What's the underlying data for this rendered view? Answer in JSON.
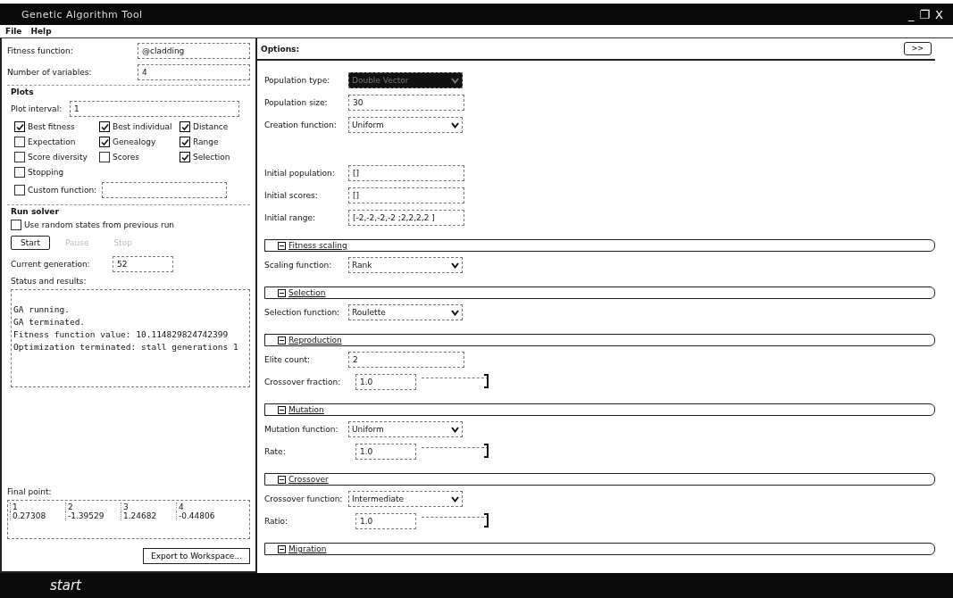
{
  "window": {
    "title": "Genetic Algorithm Tool",
    "controls": [
      "_",
      "❐",
      "X"
    ]
  },
  "menu": [
    "File",
    "Help"
  ],
  "problem": [
    {
      "label": "Fitness function:",
      "value": "@cladding"
    },
    {
      "label": "Number of variables:",
      "value": "4"
    }
  ],
  "plots": {
    "title": "Plots",
    "interval_label": "Plot interval:",
    "interval": "1",
    "checks": [
      {
        "label": "Best fitness",
        "checked": true
      },
      {
        "label": "Best individual",
        "checked": true
      },
      {
        "label": "Distance",
        "checked": true
      },
      {
        "label": "Expectation",
        "checked": false
      },
      {
        "label": "Genealogy",
        "checked": true
      },
      {
        "label": "Range",
        "checked": true
      },
      {
        "label": "Score diversity",
        "checked": false
      },
      {
        "label": "Scores",
        "checked": false
      },
      {
        "label": "Selection",
        "checked": true
      },
      {
        "label": "Stopping",
        "checked": false
      }
    ],
    "custom": {
      "label": "Custom function:",
      "checked": false
    }
  },
  "run_solver": {
    "title": "Run solver",
    "random_states": {
      "label": "Use random states from previous run",
      "checked": false
    },
    "buttons": [
      {
        "label": "Start",
        "disabled": false
      },
      {
        "label": "Pause",
        "disabled": true
      },
      {
        "label": "Stop",
        "disabled": true
      }
    ],
    "generation_label": "Current generation:",
    "generation": "52",
    "status_label": "Status and results:",
    "status_lines": [
      "GA running.",
      "GA terminated.",
      "Fitness function value: 10.114829824742399",
      "Optimization terminated: stall generations 1"
    ]
  },
  "final_point": {
    "label": "Final point:",
    "columns": [
      "1",
      "2",
      "3",
      "4"
    ],
    "values": [
      "0.27308",
      "-1.39529",
      "1.24682",
      "-0.44806"
    ]
  },
  "export_button": "Export to Workspace...",
  "options": {
    "title": "Options:",
    "toggle": ">>",
    "general": [
      {
        "kind": "select",
        "label": "Population type:",
        "value": "Double Vector",
        "selected": true
      },
      {
        "kind": "field",
        "label": "Population size:",
        "value": "30"
      },
      {
        "kind": "select",
        "label": "Creation function:",
        "value": "Uniform",
        "selected": false
      },
      {
        "kind": "gap"
      },
      {
        "kind": "field",
        "label": "Initial population:",
        "value": "[]"
      },
      {
        "kind": "field",
        "label": "Initial scores:",
        "value": "[]"
      },
      {
        "kind": "field",
        "label": "Initial range:",
        "value": "[-2,-2,-2,-2 ;2,2,2,2 ]"
      }
    ],
    "sections": [
      {
        "title": "Fitness scaling",
        "expanded": true,
        "rows": [
          {
            "kind": "select",
            "label": "Scaling function:",
            "value": "Rank",
            "selected": false
          }
        ]
      },
      {
        "title": "Selection",
        "expanded": true,
        "rows": [
          {
            "kind": "select",
            "label": "Selection function:",
            "value": "Roulette",
            "selected": false
          }
        ]
      },
      {
        "title": "Reproduction",
        "expanded": true,
        "rows": [
          {
            "kind": "field",
            "label": "Elite count:",
            "value": "2"
          },
          {
            "kind": "slider",
            "label": "Crossover fraction:",
            "value": "1.0",
            "level": 1
          }
        ]
      },
      {
        "title": "Mutation",
        "expanded": true,
        "rows": [
          {
            "kind": "select",
            "label": "Mutation function:",
            "value": "Uniform",
            "selected": false
          },
          {
            "kind": "slider",
            "label": "Rate:",
            "value": "1.0",
            "level": 1
          }
        ]
      },
      {
        "title": "Crossover",
        "expanded": true,
        "rows": [
          {
            "kind": "select",
            "label": "Crossover function:",
            "value": "Intermediate",
            "selected": false
          },
          {
            "kind": "slider",
            "label": "Ratio:",
            "value": "1.0",
            "level": 1
          }
        ]
      },
      {
        "title": "Migration",
        "expanded": true
      }
    ]
  },
  "taskbar": {
    "start": "start"
  }
}
